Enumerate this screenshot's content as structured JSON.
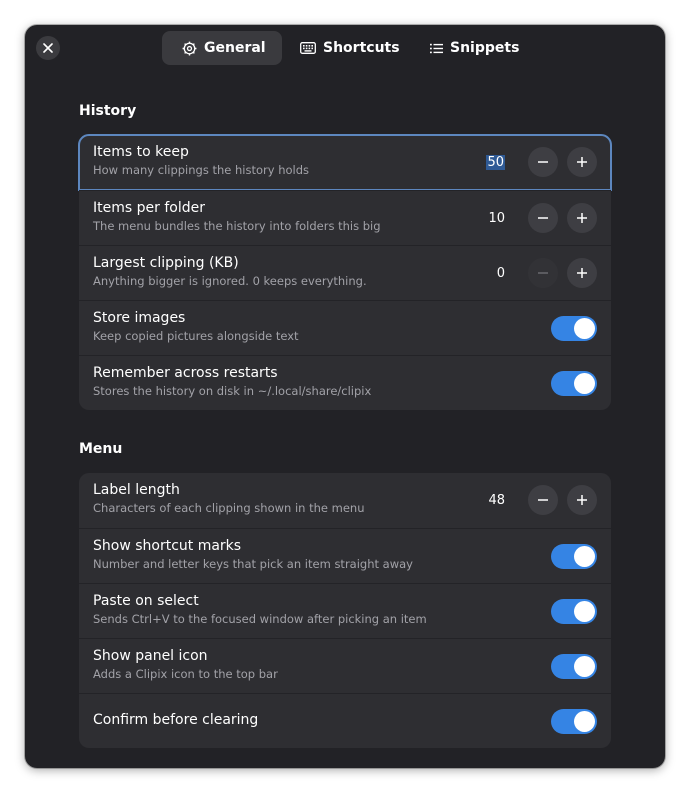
{
  "tabs": [
    {
      "label": "General",
      "icon": "gear-icon",
      "active": true
    },
    {
      "label": "Shortcuts",
      "icon": "keyboard-icon",
      "active": false
    },
    {
      "label": "Snippets",
      "icon": "list-icon",
      "active": false
    }
  ],
  "history": {
    "title": "History",
    "rows": [
      {
        "title": "Items to keep",
        "subtitle": "How many clippings the history holds",
        "value": "50"
      },
      {
        "title": "Items per folder",
        "subtitle": "The menu bundles the history into folders this big",
        "value": "10"
      },
      {
        "title": "Largest clipping (KB)",
        "subtitle": "Anything bigger is ignored. 0 keeps everything.",
        "value": "0"
      },
      {
        "title": "Store images",
        "subtitle": "Keep copied pictures alongside text",
        "on": true
      },
      {
        "title": "Remember across restarts",
        "subtitle": "Stores the history on disk in ~/.local/share/clipix",
        "on": true
      }
    ]
  },
  "menu": {
    "title": "Menu",
    "rows": [
      {
        "title": "Label length",
        "subtitle": "Characters of each clipping shown in the menu",
        "value": "48"
      },
      {
        "title": "Show shortcut marks",
        "subtitle": "Number and letter keys that pick an item straight away",
        "on": true
      },
      {
        "title": "Paste on select",
        "subtitle": "Sends Ctrl+V to the focused window after picking an item",
        "on": true
      },
      {
        "title": "Show panel icon",
        "subtitle": "Adds a Clipix icon to the top bar",
        "on": true
      },
      {
        "title": "Confirm before clearing",
        "on": true
      }
    ]
  },
  "colors": {
    "window_bg": "#222226",
    "card_bg": "#2e2e32",
    "accent": "#3584e4",
    "focus_outline": "#5d87bf"
  }
}
